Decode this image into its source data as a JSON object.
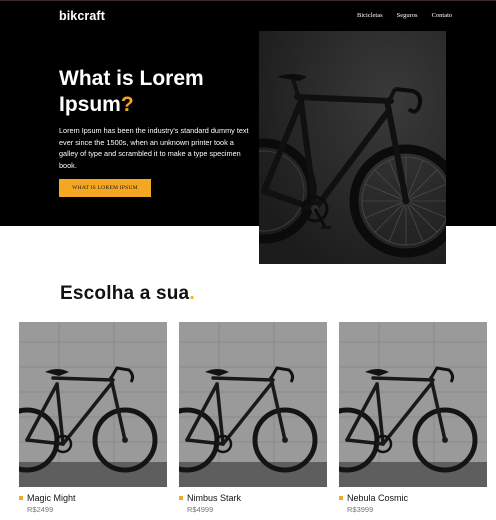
{
  "brand": {
    "name": "bikcraft",
    "accent": "#f5a623"
  },
  "nav": {
    "items": [
      "Bicicletas",
      "Seguros",
      "Contato"
    ]
  },
  "hero": {
    "title_main": "What is Lorem Ipsum",
    "title_mark": "?",
    "text": "Lorem Ipsum has been the industry's standard dummy text ever since the 1500s, when an unknown printer took a galley of type and scrambled it to make a type specimen book.",
    "button_label": "WHAT IS LOREM IPSUM"
  },
  "section": {
    "title": "Escolha a sua",
    "title_mark": "."
  },
  "products": [
    {
      "name": "Magic Might",
      "price": "R$2499"
    },
    {
      "name": "Nimbus Stark",
      "price": "R$4999"
    },
    {
      "name": "Nebula Cosmic",
      "price": "R$3999"
    }
  ]
}
